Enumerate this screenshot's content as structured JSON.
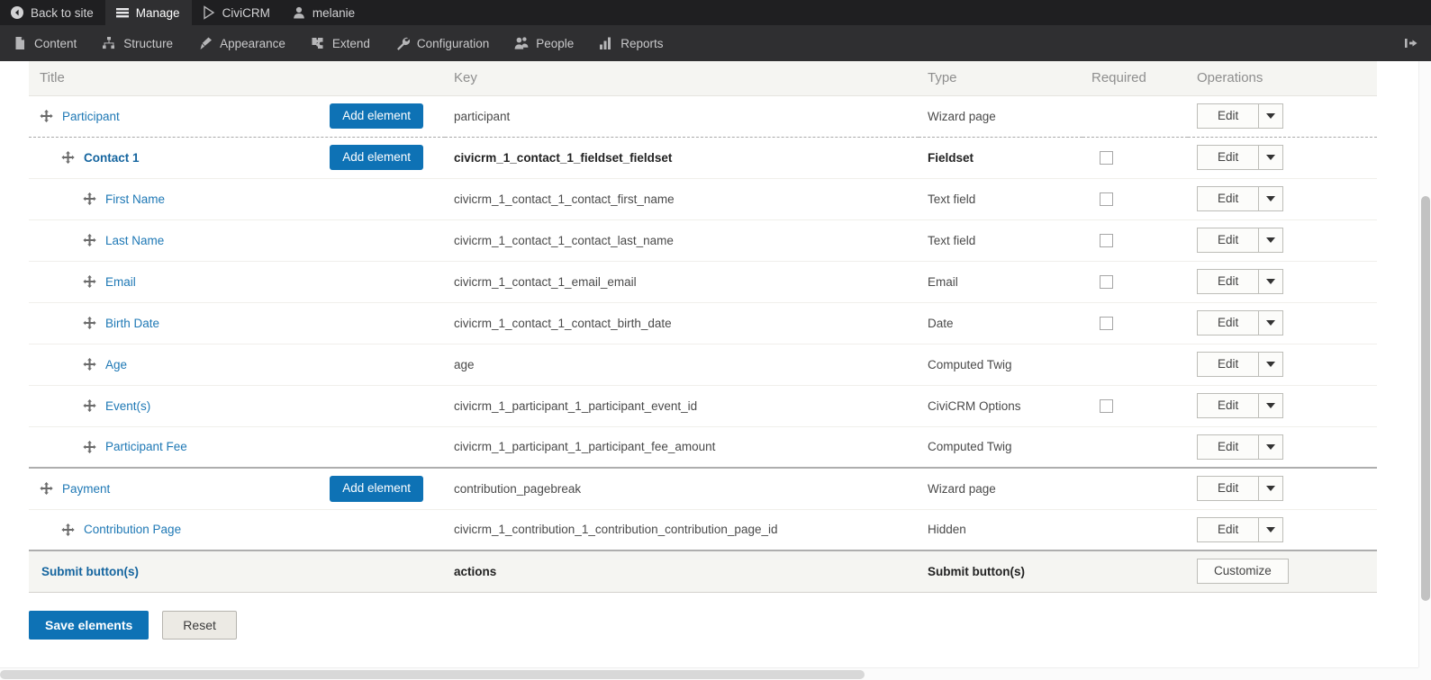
{
  "toolbar": {
    "top_items": [
      {
        "label": "Back to site",
        "icon": "back-arrow-icon",
        "active": false
      },
      {
        "label": "Manage",
        "icon": "hamburger-icon",
        "active": true
      },
      {
        "label": "CiviCRM",
        "icon": "civicrm-icon",
        "active": false
      },
      {
        "label": "melanie",
        "icon": "user-icon",
        "active": false
      }
    ],
    "menu_items": [
      {
        "label": "Content",
        "icon": "document-icon"
      },
      {
        "label": "Structure",
        "icon": "sitemap-icon"
      },
      {
        "label": "Appearance",
        "icon": "paintbrush-icon"
      },
      {
        "label": "Extend",
        "icon": "puzzle-piece-icon"
      },
      {
        "label": "Configuration",
        "icon": "wrench-icon"
      },
      {
        "label": "People",
        "icon": "people-icon"
      },
      {
        "label": "Reports",
        "icon": "bar-chart-icon"
      }
    ],
    "collapse_icon": "collapse-toolbar-icon"
  },
  "table": {
    "columns": {
      "title": "Title",
      "key": "Key",
      "type": "Type",
      "required": "Required",
      "operations": "Operations"
    },
    "rows": [
      {
        "title": "Participant",
        "indent": 0,
        "bold": false,
        "key": "participant",
        "key_bold": false,
        "type": "Wizard page",
        "type_bold": false,
        "has_add_element": true,
        "add_element_label": "Add element",
        "has_required_checkbox": false,
        "required_checked": false,
        "ops": "edit",
        "edit_label": "Edit",
        "divider": "dashed"
      },
      {
        "title": "Contact 1",
        "indent": 1,
        "bold": true,
        "key": "civicrm_1_contact_1_fieldset_fieldset",
        "key_bold": true,
        "type": "Fieldset",
        "type_bold": true,
        "has_add_element": true,
        "add_element_label": "Add element",
        "has_required_checkbox": true,
        "required_checked": false,
        "ops": "edit",
        "edit_label": "Edit",
        "divider": "normal"
      },
      {
        "title": "First Name",
        "indent": 2,
        "bold": false,
        "key": "civicrm_1_contact_1_contact_first_name",
        "key_bold": false,
        "type": "Text field",
        "type_bold": false,
        "has_add_element": false,
        "add_element_label": "",
        "has_required_checkbox": true,
        "required_checked": false,
        "ops": "edit",
        "edit_label": "Edit",
        "divider": "normal"
      },
      {
        "title": "Last Name",
        "indent": 2,
        "bold": false,
        "key": "civicrm_1_contact_1_contact_last_name",
        "key_bold": false,
        "type": "Text field",
        "type_bold": false,
        "has_add_element": false,
        "add_element_label": "",
        "has_required_checkbox": true,
        "required_checked": false,
        "ops": "edit",
        "edit_label": "Edit",
        "divider": "normal"
      },
      {
        "title": "Email",
        "indent": 2,
        "bold": false,
        "key": "civicrm_1_contact_1_email_email",
        "key_bold": false,
        "type": "Email",
        "type_bold": false,
        "has_add_element": false,
        "add_element_label": "",
        "has_required_checkbox": true,
        "required_checked": false,
        "ops": "edit",
        "edit_label": "Edit",
        "divider": "normal"
      },
      {
        "title": "Birth Date",
        "indent": 2,
        "bold": false,
        "key": "civicrm_1_contact_1_contact_birth_date",
        "key_bold": false,
        "type": "Date",
        "type_bold": false,
        "has_add_element": false,
        "add_element_label": "",
        "has_required_checkbox": true,
        "required_checked": false,
        "ops": "edit",
        "edit_label": "Edit",
        "divider": "normal"
      },
      {
        "title": "Age",
        "indent": 2,
        "bold": false,
        "key": "age",
        "key_bold": false,
        "type": "Computed Twig",
        "type_bold": false,
        "has_add_element": false,
        "add_element_label": "",
        "has_required_checkbox": false,
        "required_checked": false,
        "ops": "edit",
        "edit_label": "Edit",
        "divider": "normal"
      },
      {
        "title": "Event(s)",
        "indent": 2,
        "bold": false,
        "key": "civicrm_1_participant_1_participant_event_id",
        "key_bold": false,
        "type": "CiviCRM Options",
        "type_bold": false,
        "has_add_element": false,
        "add_element_label": "",
        "has_required_checkbox": true,
        "required_checked": false,
        "ops": "edit",
        "edit_label": "Edit",
        "divider": "normal"
      },
      {
        "title": "Participant Fee",
        "indent": 2,
        "bold": false,
        "key": "civicrm_1_participant_1_participant_fee_amount",
        "key_bold": false,
        "type": "Computed Twig",
        "type_bold": false,
        "has_add_element": false,
        "add_element_label": "",
        "has_required_checkbox": false,
        "required_checked": false,
        "ops": "edit",
        "edit_label": "Edit",
        "divider": "normal"
      },
      {
        "title": "Payment",
        "indent": 0,
        "bold": false,
        "key": "contribution_pagebreak",
        "key_bold": false,
        "type": "Wizard page",
        "type_bold": false,
        "has_add_element": true,
        "add_element_label": "Add element",
        "has_required_checkbox": false,
        "required_checked": false,
        "ops": "edit",
        "edit_label": "Edit",
        "divider": "normal",
        "thick_above": true
      },
      {
        "title": "Contribution Page",
        "indent": 1,
        "bold": false,
        "key": "civicrm_1_contribution_1_contribution_contribution_page_id",
        "key_bold": false,
        "type": "Hidden",
        "type_bold": false,
        "has_add_element": false,
        "add_element_label": "",
        "has_required_checkbox": false,
        "required_checked": false,
        "ops": "edit",
        "edit_label": "Edit",
        "divider": "normal"
      },
      {
        "title": "Submit button(s)",
        "indent": 0,
        "bold": true,
        "no_drag": true,
        "key": "actions",
        "key_bold": true,
        "type": "Submit button(s)",
        "type_bold": true,
        "has_add_element": false,
        "add_element_label": "",
        "has_required_checkbox": false,
        "required_checked": false,
        "ops": "customize",
        "customize_label": "Customize",
        "divider": "submit"
      }
    ]
  },
  "actions": {
    "save_label": "Save elements",
    "reset_label": "Reset"
  },
  "colors": {
    "accent_blue": "#0e72b5",
    "link_blue": "#1e78b5",
    "toolbar_dark": "#1f1f21",
    "toolbar_menu": "#2f2f31",
    "header_bg": "#f5f5f2"
  }
}
